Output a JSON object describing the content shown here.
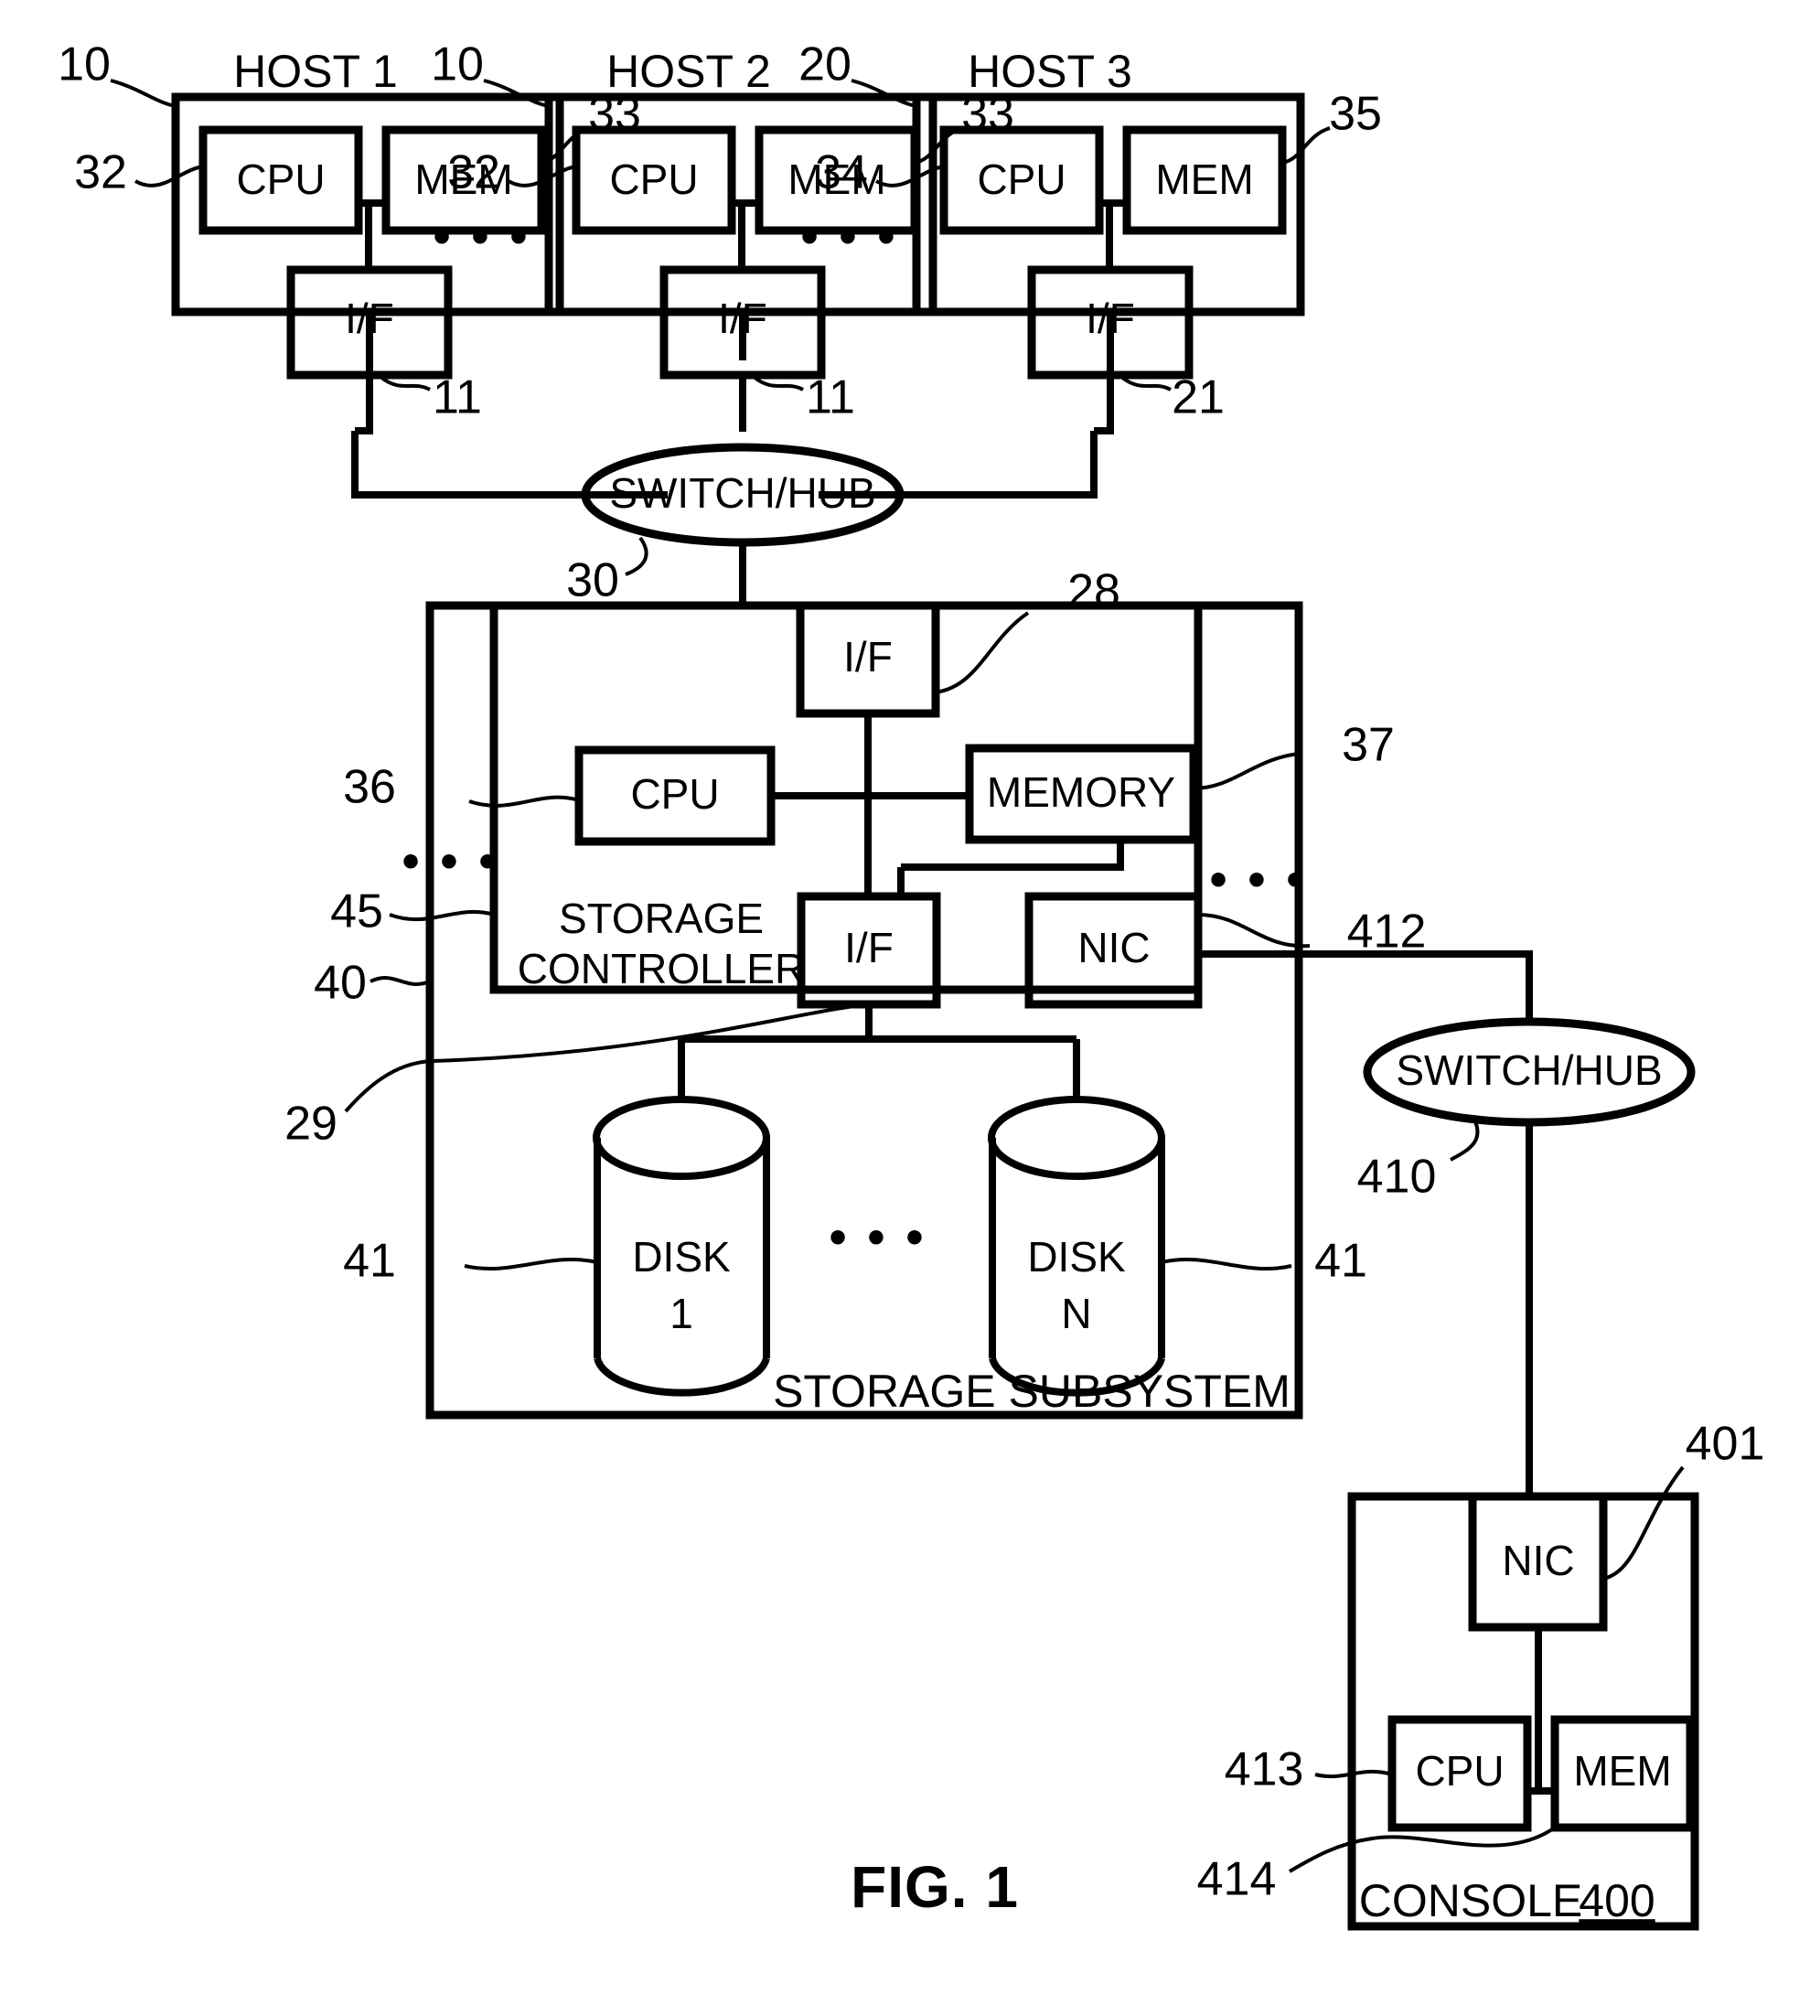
{
  "figure": {
    "caption": "FIG. 1",
    "ellipsis": "• • •"
  },
  "hosts": [
    {
      "title": "HOST 1",
      "box_ref": "10",
      "cpu_label": "CPU",
      "cpu_ref": "32",
      "mem_label": "MEM",
      "mem_ref": "33",
      "if_label": "I/F",
      "if_ref": "11"
    },
    {
      "title": "HOST 2",
      "box_ref": "10",
      "cpu_label": "CPU",
      "cpu_ref": "32",
      "mem_label": "MEM",
      "mem_ref": "33",
      "if_label": "I/F",
      "if_ref": "11"
    },
    {
      "title": "HOST 3",
      "box_ref": "20",
      "cpu_label": "CPU",
      "cpu_ref": "34",
      "mem_label": "MEM",
      "mem_ref": "35",
      "if_label": "I/F",
      "if_ref": "21"
    }
  ],
  "front_network": {
    "switch_label": "SWITCH/HUB",
    "switch_ref": "30"
  },
  "storage_subsystem": {
    "title": "STORAGE SUBSYSTEM",
    "ref": "40",
    "controller_line1": "STORAGE",
    "controller_line2": "CONTROLLER",
    "controller_ref": "45",
    "host_if_label": "I/F",
    "host_if_ref": "28",
    "cpu_label": "CPU",
    "cpu_ref": "36",
    "memory_label": "MEMORY",
    "memory_ref": "37",
    "disk_if_label": "I/F",
    "disk_if_ref": "29",
    "nic_label": "NIC",
    "nic_ref": "412",
    "disks": [
      {
        "line1": "DISK",
        "line2": "1",
        "ref": "41"
      },
      {
        "line1": "DISK",
        "line2": "N",
        "ref": "41"
      }
    ]
  },
  "management_network": {
    "switch_label": "SWITCH/HUB",
    "switch_ref": "410"
  },
  "console": {
    "title": "CONSOLE",
    "title_ref": "400",
    "nic_label": "NIC",
    "nic_ref": "401",
    "cpu_label": "CPU",
    "cpu_ref": "413",
    "mem_label": "MEM",
    "mem_ref": "414"
  }
}
